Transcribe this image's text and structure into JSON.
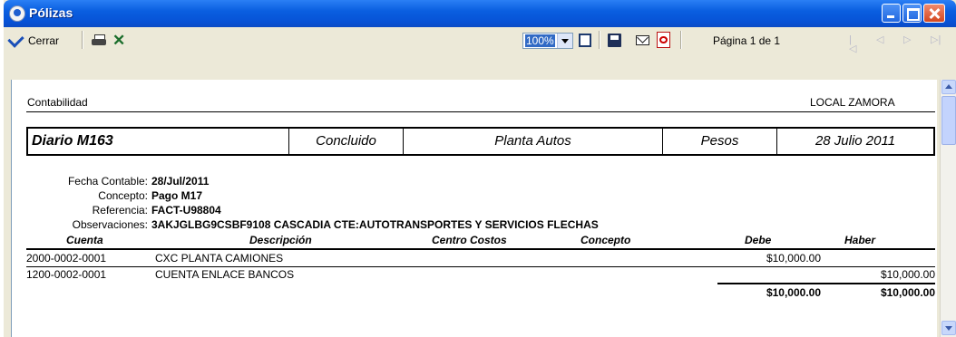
{
  "window": {
    "title": "Pólizas"
  },
  "toolbar": {
    "close_label": "Cerrar",
    "zoom_value": "100%",
    "page_status": "Página 1 de 1"
  },
  "report": {
    "area_label": "Contabilidad",
    "company": "LOCAL ZAMORA",
    "header": {
      "diario": "Diario  M163",
      "status": "Concluido",
      "plant": "Planta Autos",
      "currency": "Pesos",
      "date": "28 Julio 2011"
    },
    "fields": [
      {
        "label": "Fecha Contable:",
        "value": "28/Jul/2011"
      },
      {
        "label": "Concepto:",
        "value": "Pago M17"
      },
      {
        "label": "Referencia:",
        "value": "FACT-U98804"
      },
      {
        "label": "Observaciones:",
        "value": "3AKJGLBG9CSBF9108 CASCADIA CTE:AUTOTRANSPORTES Y SERVICIOS FLECHAS"
      }
    ],
    "columns": [
      "Cuenta",
      "Descripción",
      "Centro Costos",
      "Concepto",
      "Debe",
      "Haber"
    ],
    "rows": [
      {
        "cuenta": "2000-0002-0001",
        "descripcion": "CXC PLANTA CAMIONES",
        "debe": "$10,000.00",
        "haber": ""
      },
      {
        "cuenta": "1200-0002-0001",
        "descripcion": "CUENTA ENLACE BANCOS",
        "debe": "",
        "haber": "$10,000.00"
      }
    ],
    "totals": {
      "debe": "$10,000.00",
      "haber": "$10,000.00"
    }
  }
}
